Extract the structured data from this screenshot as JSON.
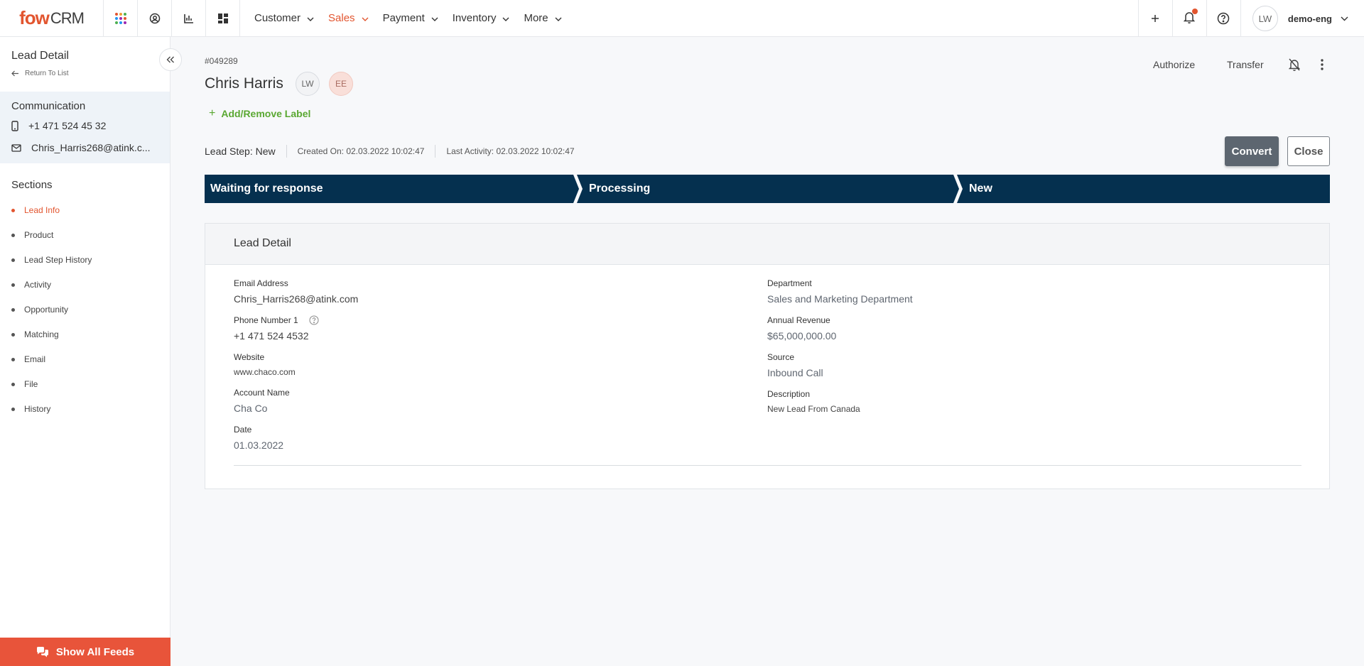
{
  "app": {
    "logo_main": "fow",
    "logo_suffix": "CRM"
  },
  "nav": {
    "menu": [
      {
        "label": "Customer",
        "active": false
      },
      {
        "label": "Sales",
        "active": true
      },
      {
        "label": "Payment",
        "active": false
      },
      {
        "label": "Inventory",
        "active": false
      },
      {
        "label": "More",
        "active": false
      }
    ],
    "icons": [
      "apps-grid-icon",
      "user-circle-icon",
      "chart-icon",
      "dashboard-icon"
    ],
    "user_initials": "LW",
    "username": "demo-eng"
  },
  "sidebar": {
    "title": "Lead Detail",
    "return_label": "Return To List",
    "communication_title": "Communication",
    "phone": "+1 471 524 45 32",
    "email": "Chris_Harris268@atink.c...",
    "sections_title": "Sections",
    "sections": [
      {
        "label": "Lead Info",
        "active": true
      },
      {
        "label": "Product",
        "active": false
      },
      {
        "label": "Lead Step History",
        "active": false
      },
      {
        "label": "Activity",
        "active": false
      },
      {
        "label": "Opportunity",
        "active": false
      },
      {
        "label": "Matching",
        "active": false
      },
      {
        "label": "Email",
        "active": false
      },
      {
        "label": "File",
        "active": false
      },
      {
        "label": "History",
        "active": false
      }
    ],
    "feeds_button": "Show All Feeds"
  },
  "lead": {
    "id": "#049289",
    "name": "Chris Harris",
    "chips": [
      "LW",
      "EE"
    ],
    "add_label": "Add/Remove Label",
    "actions": {
      "authorize": "Authorize",
      "transfer": "Transfer"
    },
    "step_text": "Lead Step: New",
    "created_on": "Created On: 02.03.2022 10:02:47",
    "last_activity": "Last Activity: 02.03.2022 10:02:47",
    "convert": "Convert",
    "close": "Close",
    "steps": [
      "Waiting for response",
      "Processing",
      "New"
    ]
  },
  "detail": {
    "title": "Lead Detail",
    "left": [
      {
        "label": "Email Address",
        "value": "Chris_Harris268@atink.com"
      },
      {
        "label": "Phone Number 1",
        "value": "+1 471 524 4532"
      },
      {
        "label": "Website",
        "value": "www.chaco.com"
      },
      {
        "label": "Account Name",
        "value": "Cha Co"
      },
      {
        "label": "Date",
        "value": "01.03.2022"
      }
    ],
    "right": [
      {
        "label": "Department",
        "value": "Sales and Marketing Department"
      },
      {
        "label": "Annual Revenue",
        "value": "$65,000,000.00"
      },
      {
        "label": "Source",
        "value": "Inbound Call"
      },
      {
        "label": "Description",
        "value": "New Lead From Canada"
      }
    ]
  },
  "colors": {
    "accent": "#e2552f",
    "step_bar": "#05304f",
    "green": "#5aa832",
    "convert": "#5d6670"
  }
}
